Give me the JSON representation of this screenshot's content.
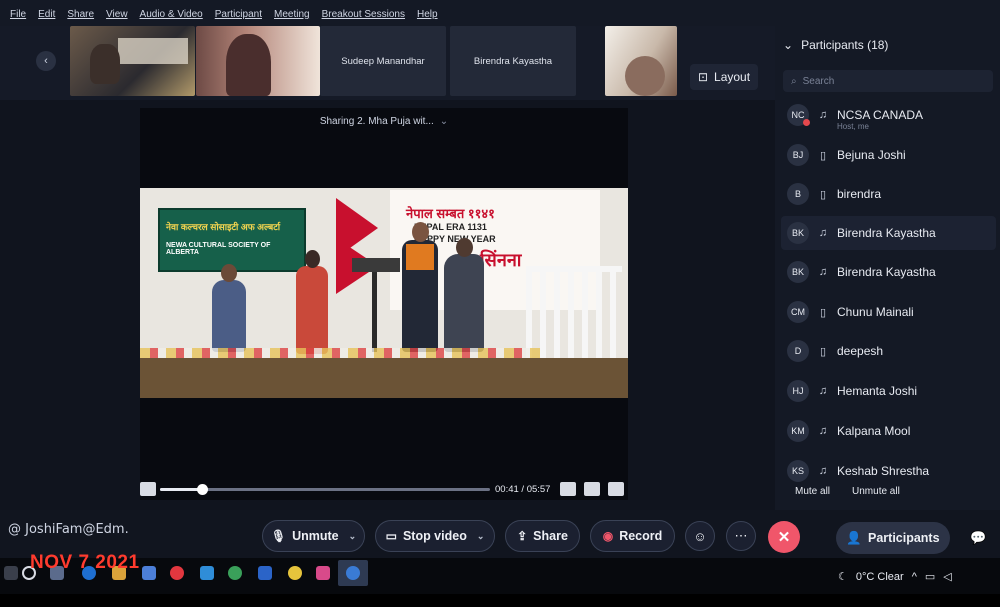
{
  "menu": [
    "File",
    "Edit",
    "Share",
    "View",
    "Audio & Video",
    "Participant",
    "Meeting",
    "Breakout Sessions",
    "Help"
  ],
  "strip": {
    "tile_names": [
      "Sudeep Manandhar",
      "Birendra Kayastha"
    ],
    "layout_label": "Layout"
  },
  "share": {
    "label": "Sharing 2. Mha Puja wit...",
    "video": {
      "banner_line1": "नेवा कल्चरल सोसाइटी अफ अल्बर्टा",
      "banner_line2": "NEWA CULTURAL SOCIETY OF ALBERTA",
      "ny_line1": "नेपाल सम्बत ११४१",
      "ny_line2": "NEPAL ERA 1131",
      "ny_line3": "HAPPY NEW YEAR",
      "ny_line4": "म्ह सिंनना"
    },
    "progress": 0.127,
    "time": "00:41 / 05:57"
  },
  "participants": {
    "title": "Participants (18)",
    "search_placeholder": "Search",
    "rows": [
      {
        "initials": "NC",
        "name": "NCSA CANADA",
        "sub": "Host, me",
        "device": "headset"
      },
      {
        "initials": "BJ",
        "name": "Bejuna Joshi",
        "device": "phone"
      },
      {
        "initials": "B",
        "name": "birendra",
        "device": "phone"
      },
      {
        "initials": "BK",
        "name": "Birendra Kayastha",
        "device": "headset"
      },
      {
        "initials": "BK",
        "name": "Birendra Kayastha",
        "device": "headset"
      },
      {
        "initials": "CM",
        "name": "Chunu Mainali",
        "device": "phone"
      },
      {
        "initials": "D",
        "name": "deepesh",
        "device": "phone"
      },
      {
        "initials": "HJ",
        "name": "Hemanta Joshi",
        "device": "headset"
      },
      {
        "initials": "KM",
        "name": "Kalpana Mool",
        "device": "headset"
      },
      {
        "initials": "KS",
        "name": "Keshab Shrestha",
        "device": "headset"
      }
    ],
    "mute_all": "Mute all",
    "unmute_all": "Unmute all"
  },
  "controls": {
    "self_name": "@ JoshiFam@Edm.",
    "unmute": "Unmute",
    "stop_video": "Stop video",
    "share": "Share",
    "record": "Record",
    "participants": "Participants",
    "accent_leave": "#f0566a"
  },
  "taskbar": {
    "date_stamp": "NOV 7 2021",
    "weather": "0°C  Clear"
  }
}
